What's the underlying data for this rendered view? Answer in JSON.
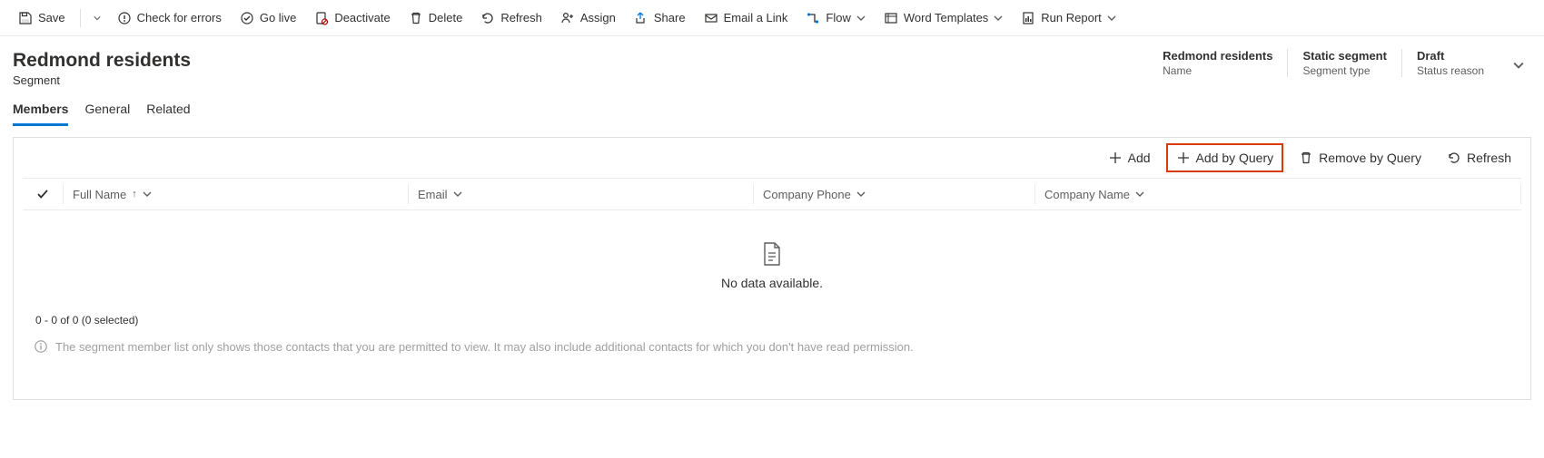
{
  "commandBar": {
    "save": "Save",
    "check": "Check for errors",
    "golive": "Go live",
    "deactivate": "Deactivate",
    "delete": "Delete",
    "refresh": "Refresh",
    "assign": "Assign",
    "share": "Share",
    "emailLink": "Email a Link",
    "flow": "Flow",
    "wordTemplates": "Word Templates",
    "runReport": "Run Report"
  },
  "header": {
    "title": "Redmond residents",
    "subtitle": "Segment",
    "fields": [
      {
        "value": "Redmond residents",
        "label": "Name"
      },
      {
        "value": "Static segment",
        "label": "Segment type"
      },
      {
        "value": "Draft",
        "label": "Status reason"
      }
    ]
  },
  "tabs": {
    "members": "Members",
    "general": "General",
    "related": "Related"
  },
  "subgrid": {
    "add": "Add",
    "addByQuery": "Add by Query",
    "removeByQuery": "Remove by Query",
    "refresh": "Refresh",
    "columns": {
      "fullName": "Full Name",
      "email": "Email",
      "companyPhone": "Company Phone",
      "companyName": "Company Name"
    },
    "empty": "No data available.",
    "pager": "0 - 0 of 0 (0 selected)",
    "note": "The segment member list only shows those contacts that you are permitted to view. It may also include additional contacts for which you don't have read permission."
  }
}
